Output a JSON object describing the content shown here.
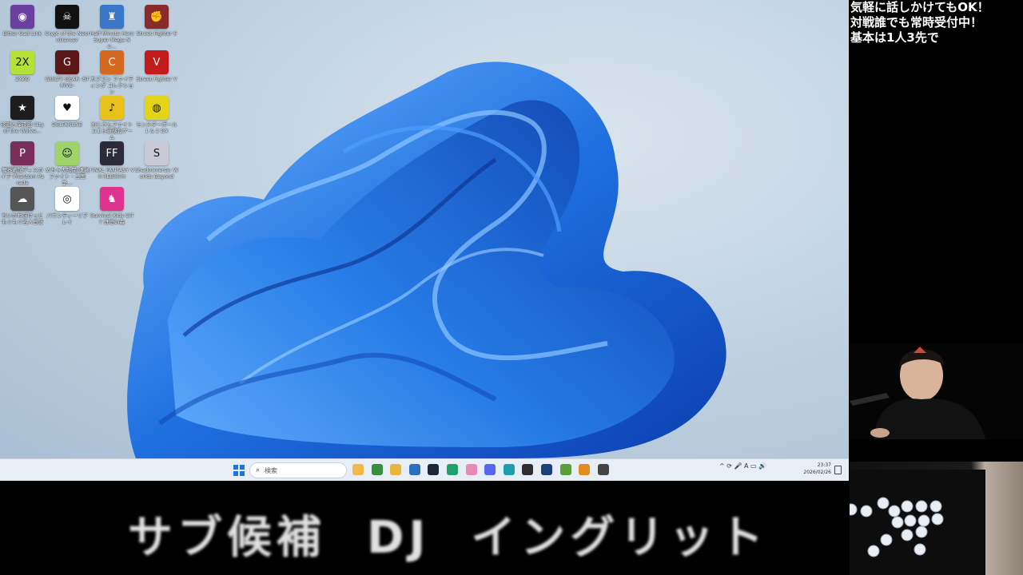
{
  "desktop": {
    "icons": [
      {
        "label": "Bitter Gad Link",
        "color": "#6b3fa0",
        "glyph": "◉"
      },
      {
        "label": "Crypt of the NecroDancer",
        "color": "#111111",
        "glyph": "☠"
      },
      {
        "label": "Half Minute Hero Super Mega Ne…",
        "color": "#3a77c9",
        "glyph": "♜"
      },
      {
        "label": "Street Fighter 6",
        "color": "#8a2a2a",
        "glyph": "✊"
      },
      {
        "label": "2XKO",
        "color": "#b5e035",
        "glyph": "2X"
      },
      {
        "label": "GUILTY GEAR -STRIVE-",
        "color": "#5a1818",
        "glyph": "G"
      },
      {
        "label": "カプコン ファイティング コレクション",
        "color": "#d4681f",
        "glyph": "C"
      },
      {
        "label": "Street Fighter V",
        "color": "#c21b1b",
        "glyph": "V"
      },
      {
        "label": "夜廻と深夜廻 City of the Wolve…",
        "color": "#1d1d1d",
        "glyph": "★"
      },
      {
        "label": "DELTARUNE",
        "color": "#ffffff",
        "glyph": "♥"
      },
      {
        "label": "おじさんファイト コエヒ新感覚ゲーム",
        "color": "#e8c11a",
        "glyph": "♪"
      },
      {
        "label": "モンスターボール 1 & 2 DX",
        "color": "#e3d41a",
        "glyph": "◍"
      },
      {
        "label": "魔界戦記ディスガイア Phantom Parade",
        "color": "#7a2f5a",
        "glyph": "P"
      },
      {
        "label": "めちゃ大乱闘!漢気ファイト・三国争…",
        "color": "#9ed36a",
        "glyph": "☺"
      },
      {
        "label": "FINAL FANTASY VII REBIRTH",
        "color": "#2b2b3a",
        "glyph": "FF"
      },
      {
        "label": "Shadowverse: Worlds Beyond",
        "color": "#c8c8d6",
        "glyph": "S"
      },
      {
        "label": "ちいかわぽけっと もぐもぐ名人日誌",
        "color": "#555555",
        "glyph": "☁"
      },
      {
        "label": "バウンティーリブレイ",
        "color": "#ffffff",
        "glyph": "◎"
      },
      {
        "label": "Survival Kids CITY 鉄塔の森",
        "color": "#e0338f",
        "glyph": "♞"
      }
    ]
  },
  "taskbar": {
    "search_placeholder": "検索",
    "pinned_apps": [
      {
        "name": "file-explorer-icon",
        "color": "#f2b84b"
      },
      {
        "name": "chrome-icon",
        "color": "#3a8e3f"
      },
      {
        "name": "folder-icon",
        "color": "#e7b63b"
      },
      {
        "name": "store-icon",
        "color": "#2a6fc0"
      },
      {
        "name": "steam-icon",
        "color": "#1b2838"
      },
      {
        "name": "app-green-icon",
        "color": "#21a06a"
      },
      {
        "name": "app-pink-icon",
        "color": "#e88ab8"
      },
      {
        "name": "discord-icon",
        "color": "#5865f2"
      },
      {
        "name": "app-teal-icon",
        "color": "#1e9bb0"
      },
      {
        "name": "obs-icon",
        "color": "#302e31"
      },
      {
        "name": "monitor-icon",
        "color": "#1d3f7a"
      },
      {
        "name": "minecraft-icon",
        "color": "#5a9e3a"
      },
      {
        "name": "app-orange-icon",
        "color": "#e58a1f"
      },
      {
        "name": "capture-icon",
        "color": "#444444"
      }
    ],
    "tray_text": "^  ⟳  🎤  A  ▭  🔊",
    "time": "23:37",
    "date": "2026/02/26"
  },
  "overlay": {
    "notice_lines": [
      "気軽に話しかけてもOK！",
      "対戦誰でも常時受付中！",
      "基本は1人3先で"
    ],
    "caption": "サブ候補  DJ  イングリット"
  },
  "colors": {
    "bloom_dark": "#0b3fb0",
    "bloom_mid": "#1f6fe0",
    "bloom_light": "#5aa9ff",
    "wallpaper": "#c2d3e2"
  }
}
